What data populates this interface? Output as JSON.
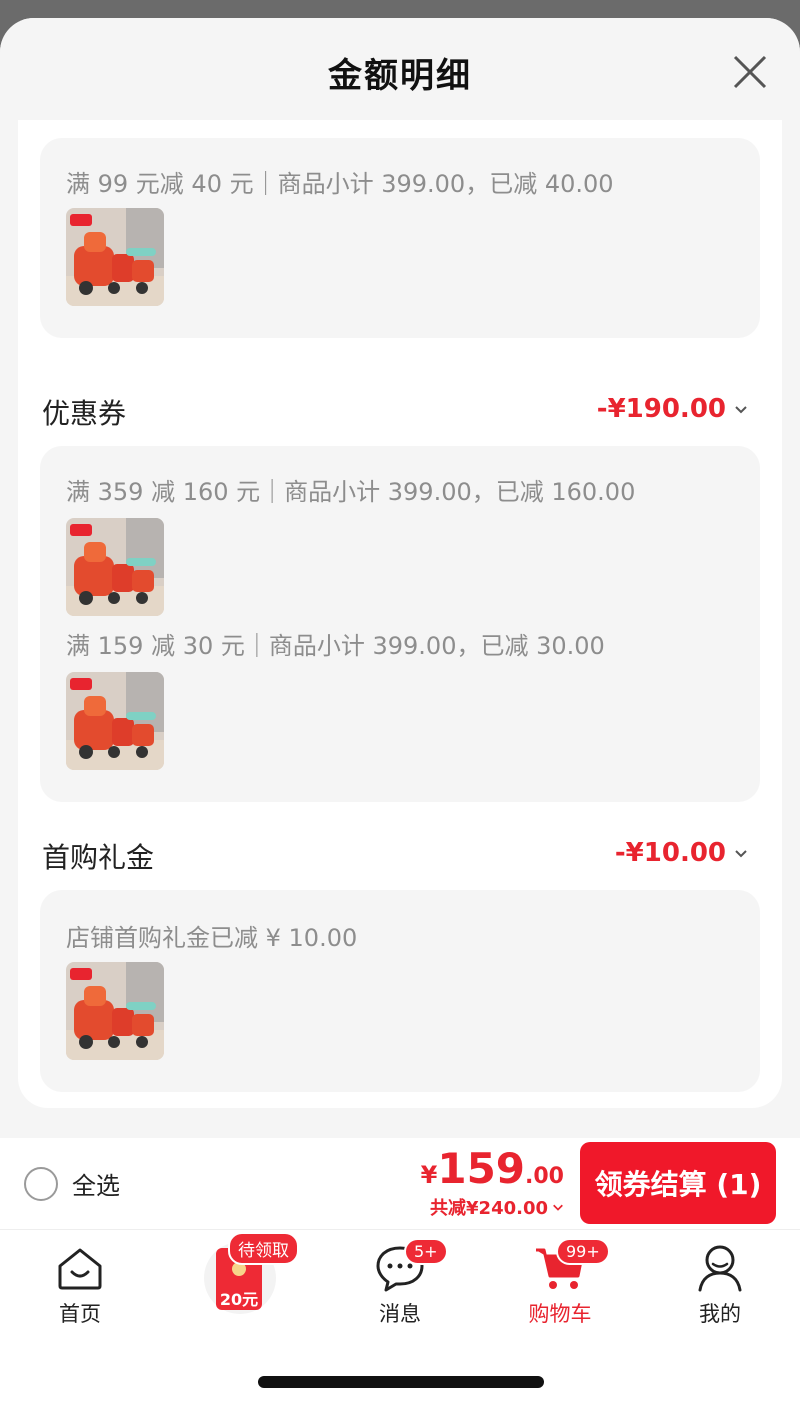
{
  "sheet": {
    "title": "金额明细"
  },
  "full_reduction": {
    "rule_line": "满 99 元减 40 元｜商品小计 399.00，已减 40.00"
  },
  "coupon": {
    "title": "优惠券",
    "amount": "-¥190.00",
    "rules": [
      "满 359 减 160 元｜商品小计 399.00，已减 160.00",
      "满 159 减 30 元｜商品小计 399.00，已减 30.00"
    ]
  },
  "first_purchase": {
    "title": "首购礼金",
    "amount": "-¥10.00",
    "rule_line": "店铺首购礼金已减 ¥ 10.00"
  },
  "checkout": {
    "select_all": "全选",
    "currency": "¥",
    "price_int": "159",
    "price_dec": ".00",
    "saved": "共减¥240.00",
    "button": "领券结算 (1)"
  },
  "tabbar": {
    "home": "首页",
    "redpacket_badge": "待领取",
    "redpacket_amount": "20元",
    "messages": "消息",
    "messages_badge": "5+",
    "cart": "购物车",
    "cart_badge": "99+",
    "me": "我的"
  },
  "colors": {
    "accent": "#e8242f",
    "button": "#f0182a"
  }
}
